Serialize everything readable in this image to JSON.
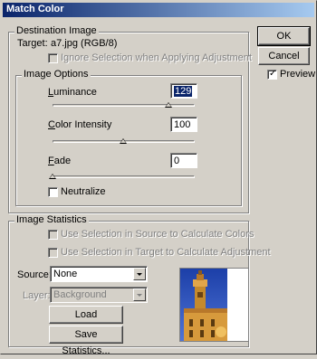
{
  "window": {
    "title": "Match Color"
  },
  "buttons": {
    "ok": "OK",
    "cancel": "Cancel"
  },
  "preview": {
    "label": "Preview",
    "checked": true
  },
  "destination": {
    "legend": "Destination Image",
    "target_label": "Target:",
    "target_value": "a7.jpg (RGB/8)",
    "ignore_selection": "Ignore Selection when Applying Adjustment"
  },
  "image_options": {
    "legend": "Image Options",
    "luminance": {
      "label": "Luminance",
      "value": "129",
      "min": 1,
      "max": 200
    },
    "color_intensity": {
      "label": "Color Intensity",
      "value": "100",
      "min": 1,
      "max": 200
    },
    "fade": {
      "label": "Fade",
      "value": "0",
      "min": 0,
      "max": 100
    },
    "neutralize": "Neutralize"
  },
  "image_statistics": {
    "legend": "Image Statistics",
    "use_selection_source": "Use Selection in Source to Calculate Colors",
    "use_selection_target": "Use Selection in Target to Calculate Adjustment",
    "source_label": "Source:",
    "source_value": "None",
    "layer_label": "Layer:",
    "layer_value": "Background",
    "load_button": "Load Statistics...",
    "save_button": "Save Statistics..."
  },
  "colors": {
    "dialog_bg": "#d4d0c8",
    "titlebar_start": "#0a246a",
    "titlebar_end": "#a6caf0",
    "disabled_text": "#808080",
    "selection": "#0a246a"
  }
}
